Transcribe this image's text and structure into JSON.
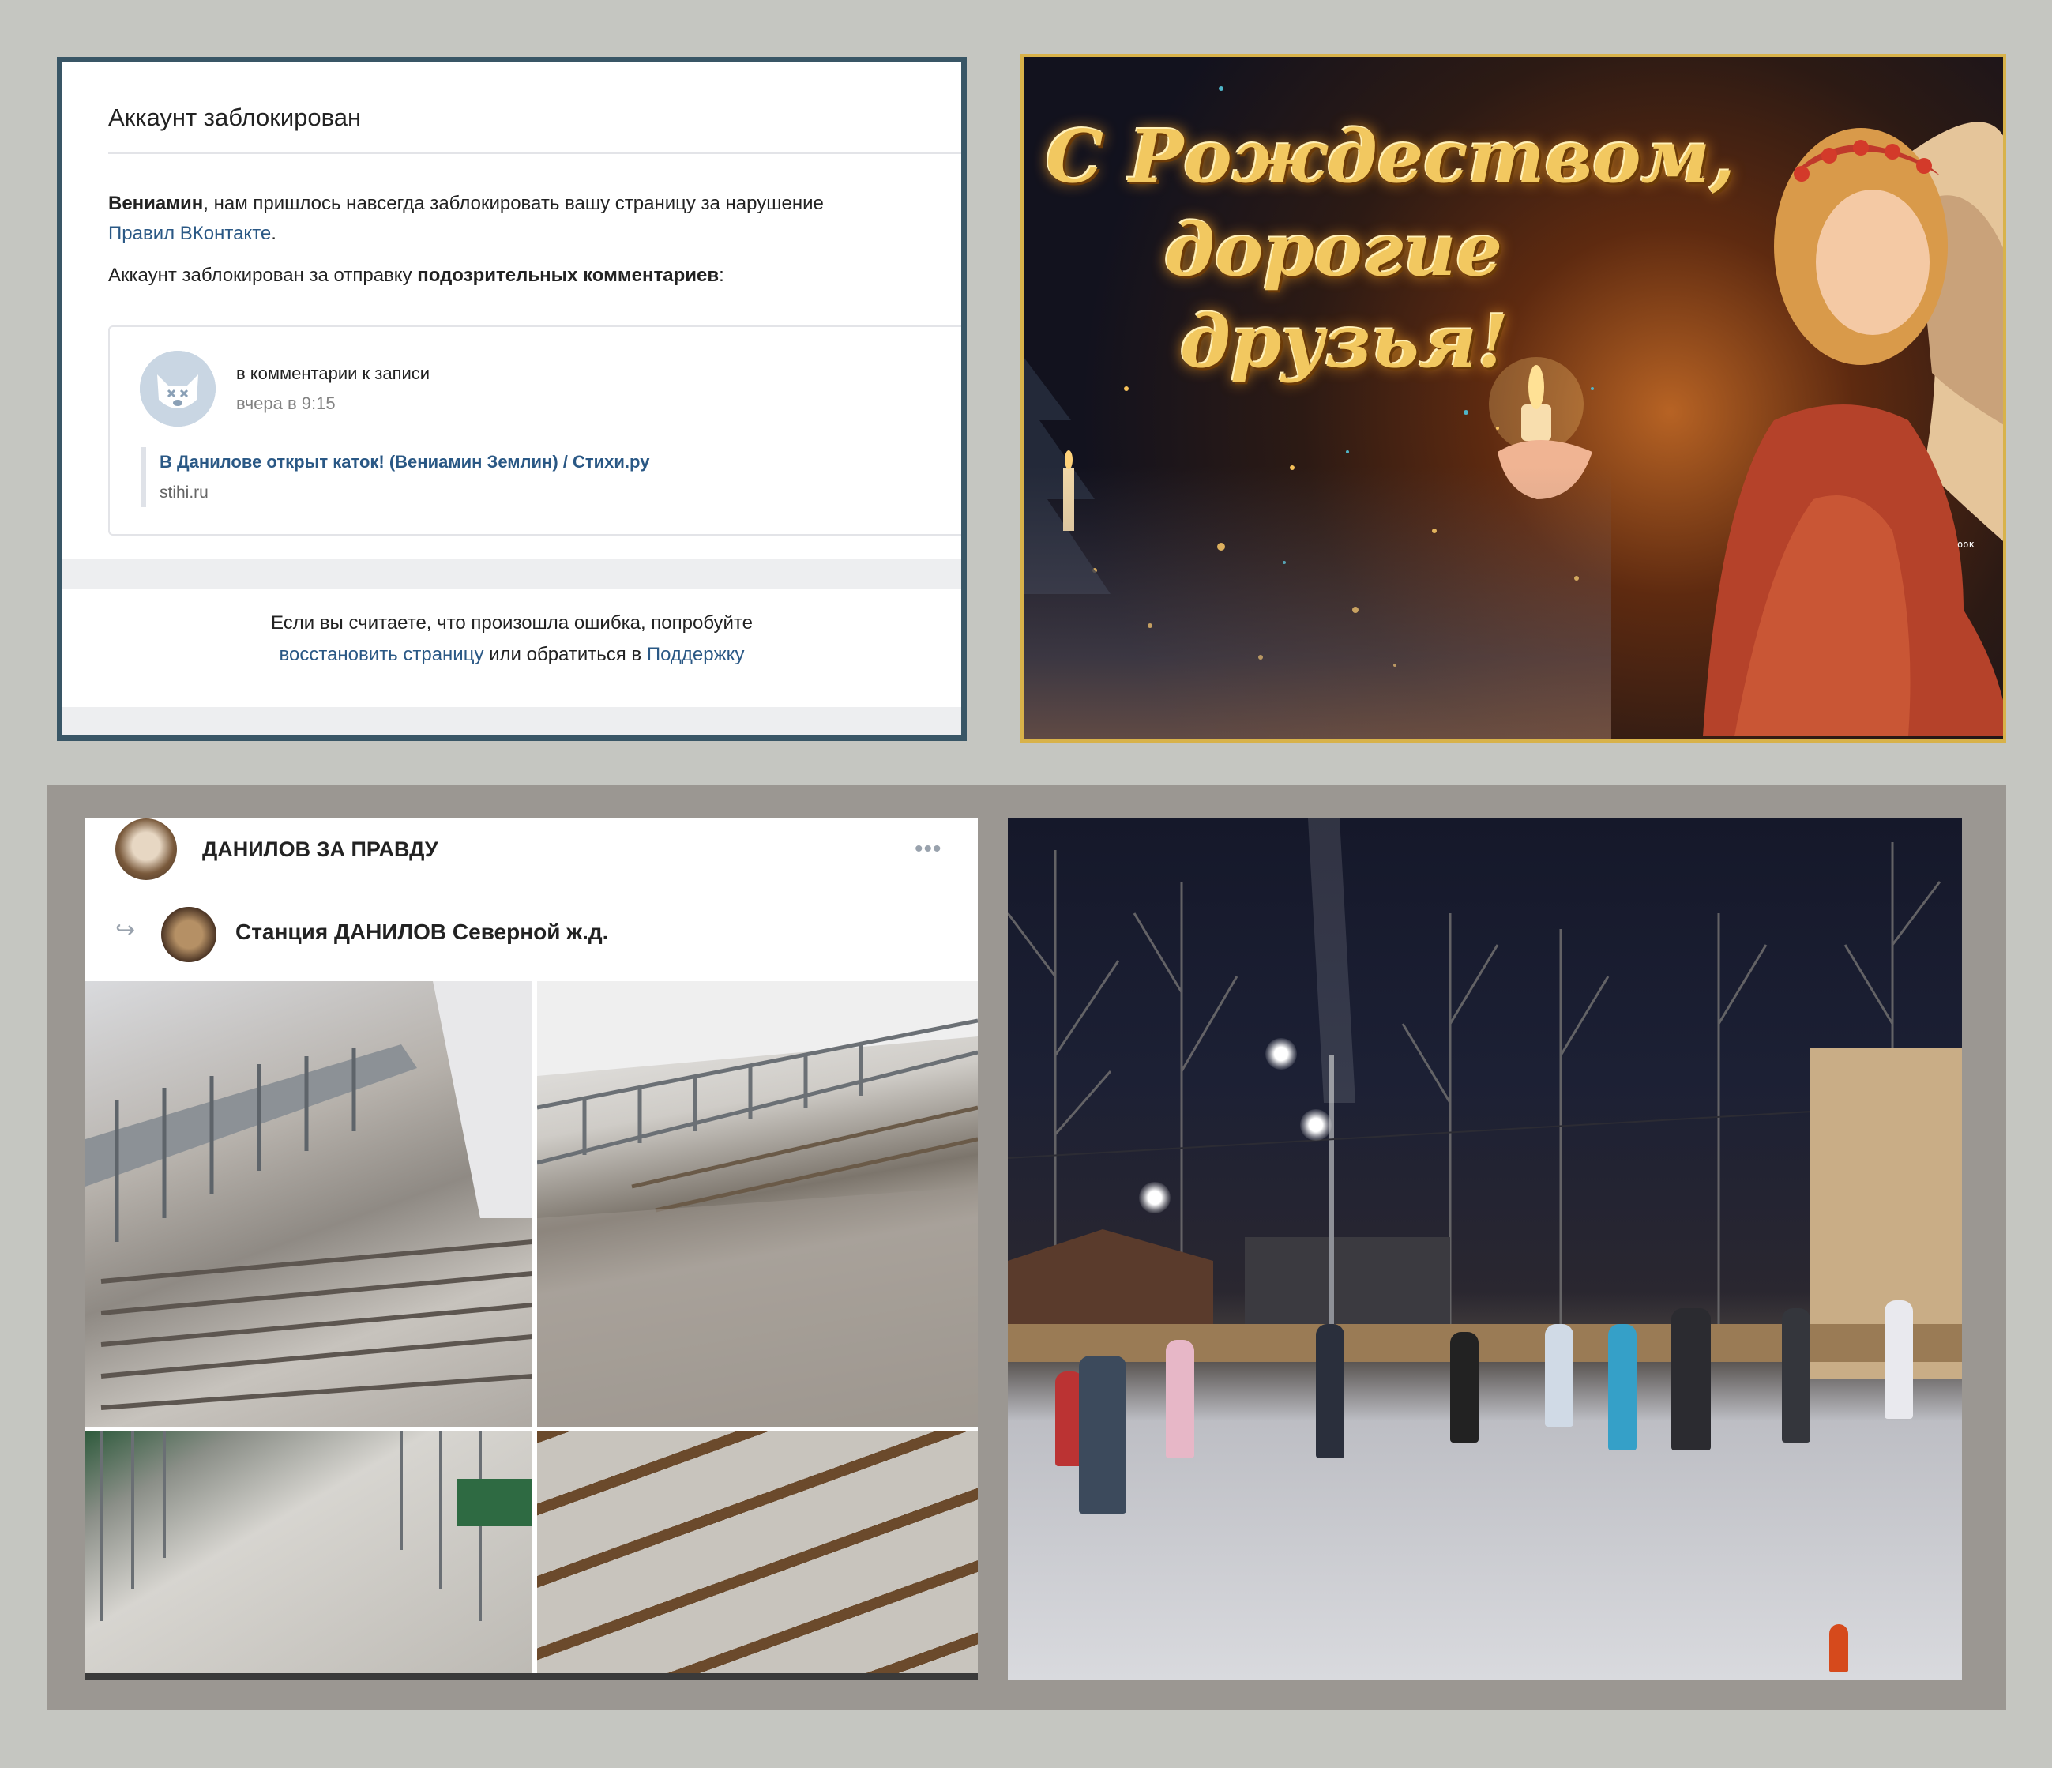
{
  "blocked_panel": {
    "title": "Аккаунт заблокирован",
    "name": "Вениамин",
    "message_middle": ", нам пришлось навсегда заблокировать вашу страницу за нарушение",
    "rules_link": "Правил ВКонтакте",
    "period": ".",
    "reason_prefix": "Аккаунт заблокирован за отправку ",
    "reason_bold": "подозрительных комментариев",
    "reason_suffix": ":",
    "comment": {
      "title": "в комментарии к записи",
      "time": "вчера в 9:15",
      "link_title": "В Данилове открыт каток! (Вениамин Землин) / Стихи.ру",
      "source": "stihi.ru"
    },
    "footer": {
      "line1": "Если вы считаете, что произошла ошибка, попробуйте",
      "restore_link": "восстановить страницу",
      "middle": " или обратиться в ",
      "support_link": "Поддержку"
    }
  },
  "christmas_card": {
    "line1": "С Рождеством,",
    "line2": "дорогие",
    "line3": "друзья!",
    "watermark": "оок"
  },
  "vk_post": {
    "group_name": "ДАНИЛОВ ЗА ПРАВДУ",
    "more_label": "•••",
    "repost_icon": "↪",
    "source_name": "Станция ДАНИЛОВ Северной ж.д."
  },
  "colors": {
    "background": "#c5c6c1",
    "vk_link": "#2a5885",
    "panel_border": "#395666",
    "card_border": "#d8b24a"
  }
}
